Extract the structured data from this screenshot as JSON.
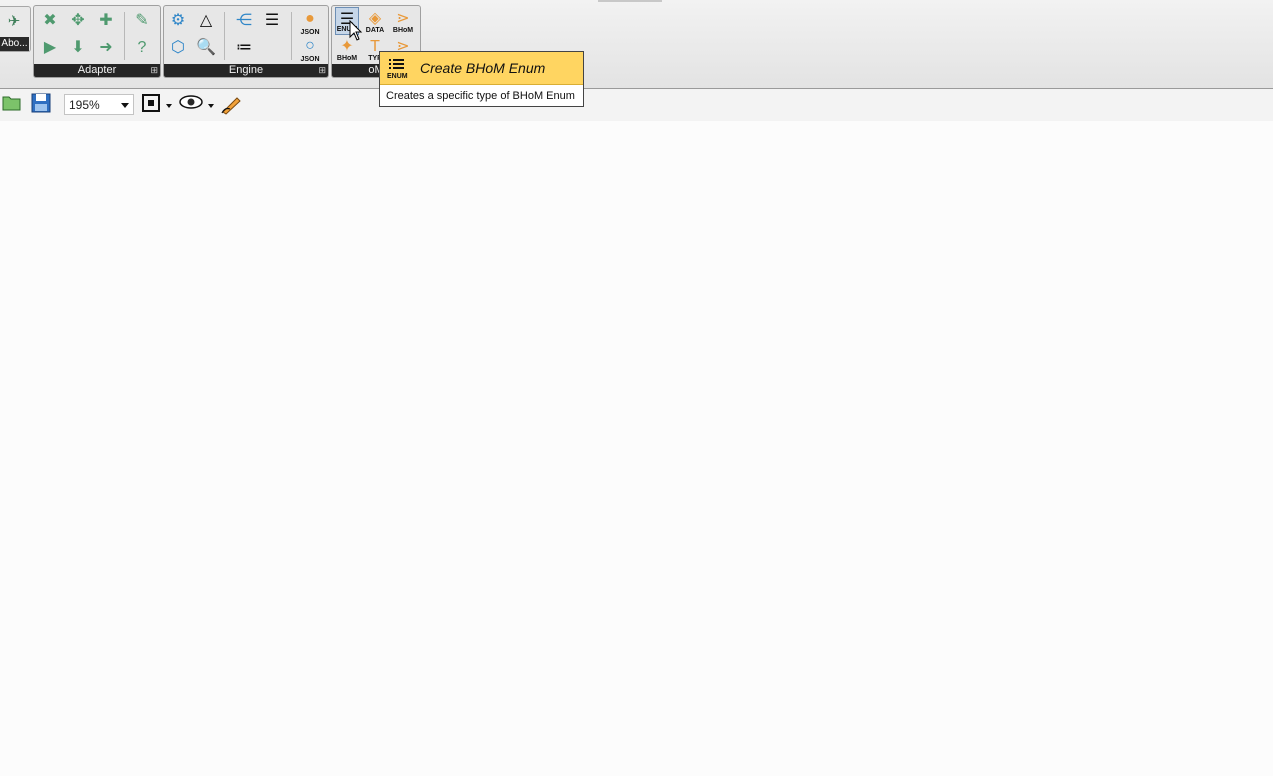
{
  "about": {
    "label": "Abo..."
  },
  "groups": {
    "adapter": {
      "label": "Adapter"
    },
    "engine": {
      "label": "Engine"
    },
    "om": {
      "label": "oM"
    }
  },
  "om_icons": {
    "enum_text": "ENUM",
    "data_text": "DATA",
    "bhom_text": "BHoM",
    "bhom_text2": "BHoM",
    "type_text": "TYP",
    "json_text": "JSON",
    "json_text2": "JSON"
  },
  "toolbar": {
    "zoom": "195%"
  },
  "tooltip": {
    "title": "Create BHoM Enum",
    "description": "Creates a specific type of BHoM Enum",
    "icon_text": "ENUM"
  },
  "colors": {
    "tooltip_header": "#ffd561",
    "canvas": "#fcfcfc",
    "label_bar": "#252525"
  }
}
